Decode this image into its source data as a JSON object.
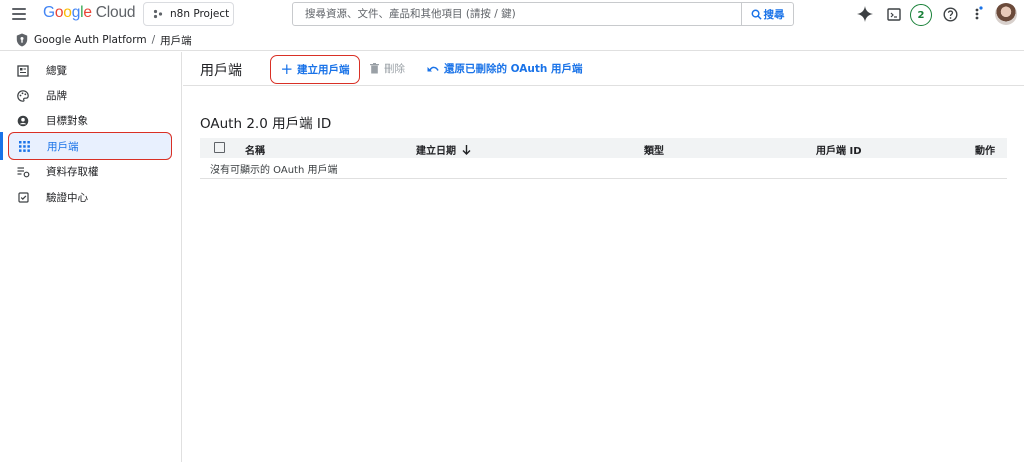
{
  "header": {
    "logo": {
      "google": "Google",
      "cloud": "Cloud"
    },
    "project": "n8n Project",
    "search_placeholder": "搜尋資源、文件、產品和其他項目 (請按 / 鍵)",
    "search_button": "搜尋",
    "notification_count": "2",
    "icons": [
      "menu-icon",
      "gemini-icon",
      "cloud-shell-icon",
      "help-icon",
      "more-vert-icon",
      "avatar"
    ]
  },
  "breadcrumb": {
    "root": "Google Auth Platform",
    "separator": "/",
    "current": "用戶端"
  },
  "sidebar": {
    "items": [
      {
        "label": "總覽",
        "icon": "dashboard-icon"
      },
      {
        "label": "品牌",
        "icon": "palette-icon"
      },
      {
        "label": "目標對象",
        "icon": "person-icon"
      },
      {
        "label": "用戶端",
        "icon": "apps-grid-icon",
        "active": true
      },
      {
        "label": "資料存取權",
        "icon": "data-access-icon"
      },
      {
        "label": "驗證中心",
        "icon": "verified-icon"
      }
    ]
  },
  "main": {
    "title": "用戶端",
    "toolbar": {
      "create": "建立用戶端",
      "delete": "刪除",
      "restore": "還原已刪除的 OAuth 用戶端"
    },
    "section_title": "OAuth 2.0 用戶端 ID",
    "table": {
      "columns": [
        "名稱",
        "建立日期",
        "類型",
        "用戶端 ID",
        "動作"
      ],
      "sort_column": "建立日期",
      "sort_direction": "descending",
      "empty_message": "沒有可顯示的 OAuth 用戶端"
    }
  },
  "colors": {
    "accent": "#1a73e8",
    "highlight_border": "#d93025",
    "active_bg": "#e8f0fe"
  }
}
